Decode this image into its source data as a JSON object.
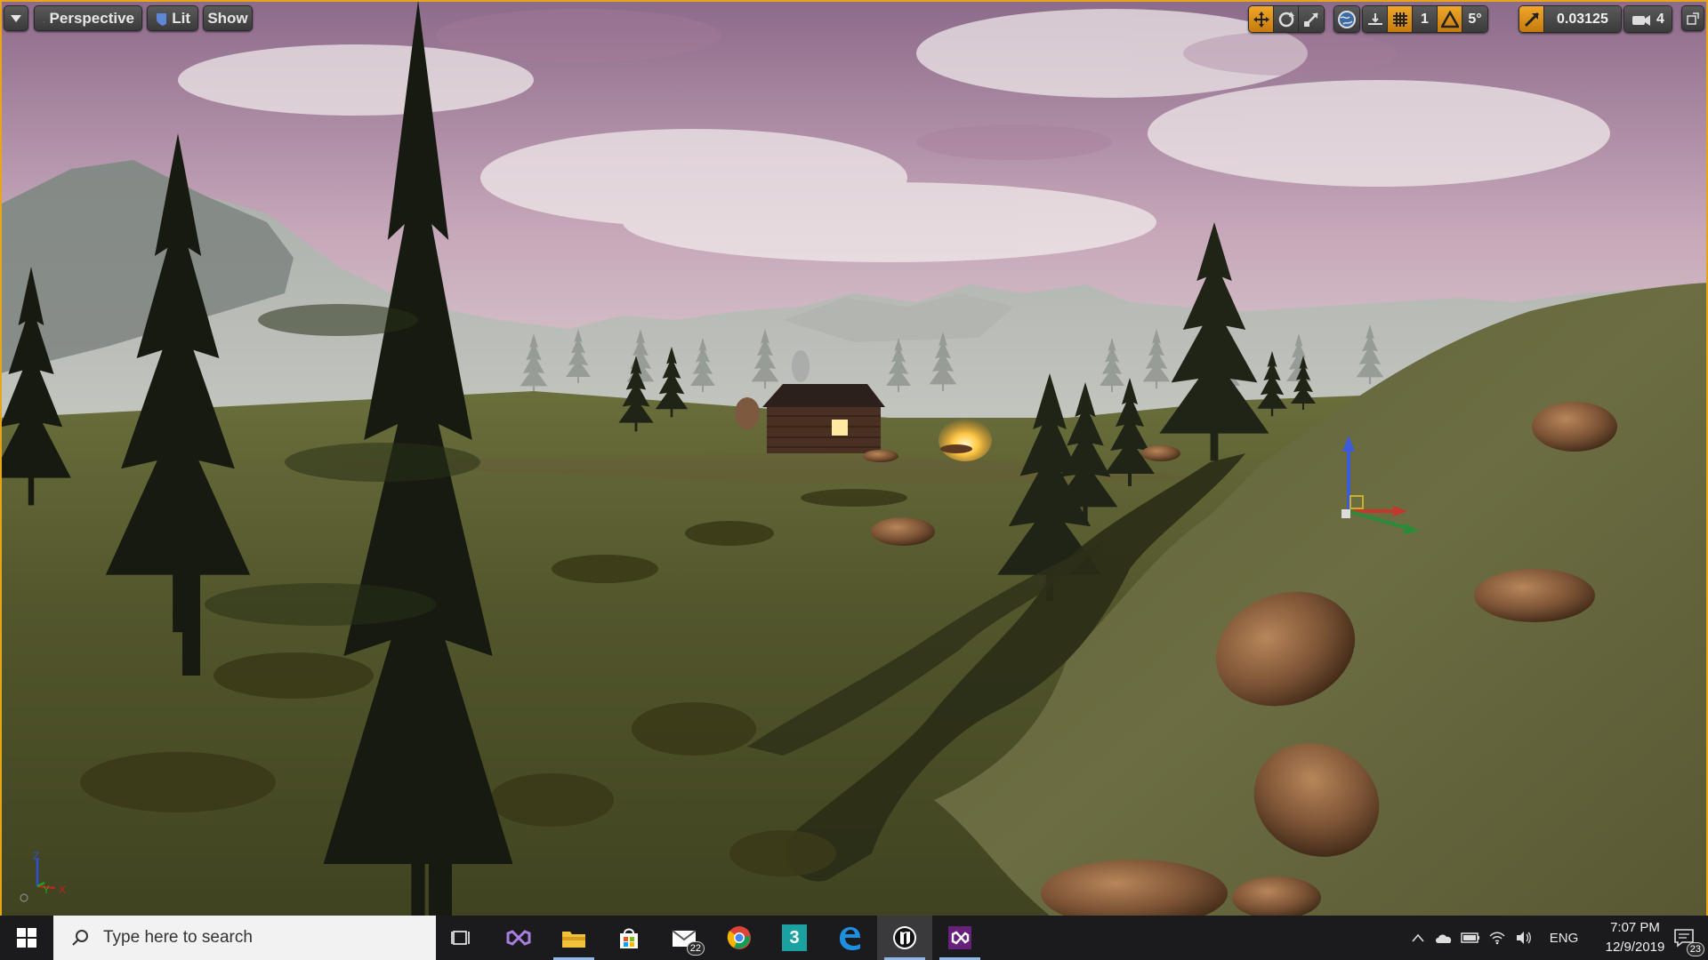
{
  "viewport": {
    "view_mode": "Perspective",
    "lighting_mode": "Lit",
    "show_label": "Show",
    "grid_snap_value": "1",
    "rotation_snap_value": "5°",
    "scale_snap_value": "0.03125",
    "camera_speed": "4",
    "axis_labels": {
      "z": "Z",
      "y": "Y",
      "x": "X"
    }
  },
  "toolbar_icons": [
    "translate-icon",
    "rotate-icon",
    "scale-icon",
    "world-local-icon",
    "surface-snap-icon",
    "grid-snap-icon",
    "rotation-snap-icon",
    "scale-snap-icon",
    "camera-speed-icon",
    "maximize-icon"
  ],
  "taskbar": {
    "search_placeholder": "Type here to search",
    "apps": [
      {
        "name": "task-view",
        "icon": "task-view-icon"
      },
      {
        "name": "visual-studio",
        "icon": "visual-studio-icon"
      },
      {
        "name": "file-explorer",
        "icon": "folder-icon"
      },
      {
        "name": "microsoft-store",
        "icon": "store-icon"
      },
      {
        "name": "mail",
        "icon": "mail-icon",
        "badge": "22"
      },
      {
        "name": "chrome",
        "icon": "chrome-icon"
      },
      {
        "name": "3ds-max",
        "icon": "3ds-max-icon",
        "label": "3"
      },
      {
        "name": "edge",
        "icon": "edge-icon"
      },
      {
        "name": "unreal-engine",
        "icon": "unreal-icon"
      },
      {
        "name": "visual-studio-code",
        "icon": "vs-purple-icon"
      }
    ],
    "tray": {
      "language": "ENG",
      "time": "7:07 PM",
      "date": "12/9/2019",
      "notifications": "23"
    }
  },
  "colors": {
    "viewport_border": "#e8a51a",
    "toolbar_active": "#e89a1c",
    "taskbar_bg": "#1b1b1d"
  }
}
